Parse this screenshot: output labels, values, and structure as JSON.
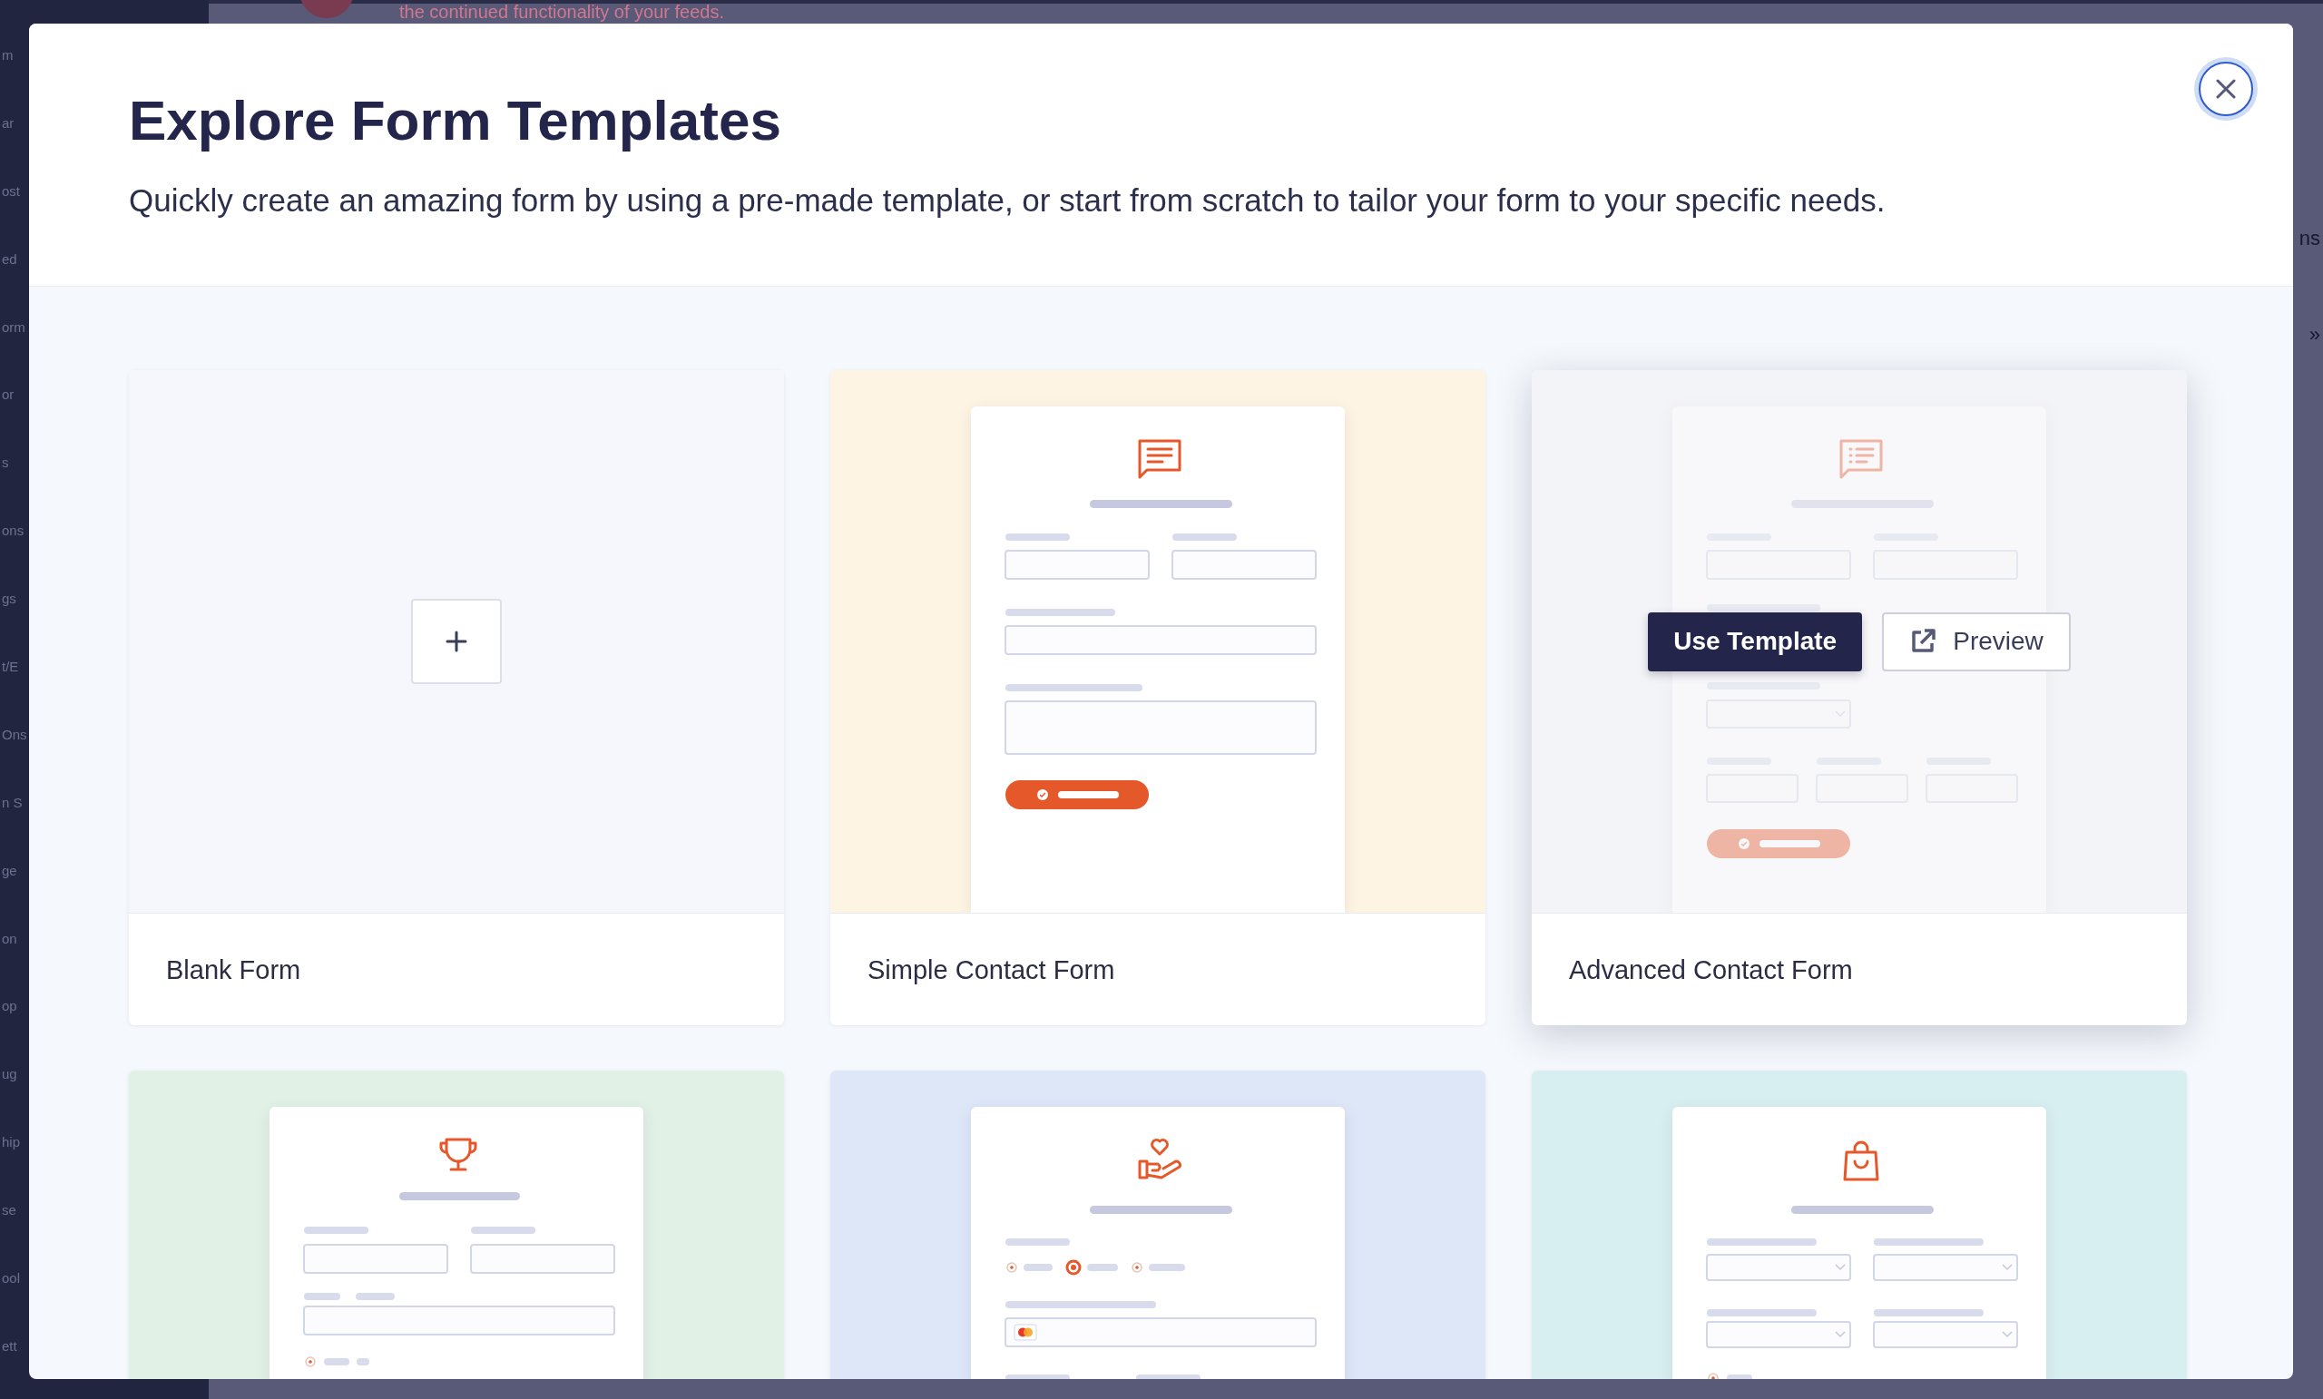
{
  "backdrop": {
    "notice": "the continued functionality of your feeds.",
    "sidebar_fragments": [
      "m",
      "ar",
      "ost",
      "ed",
      "orm",
      "or",
      "s",
      "ons",
      "gs",
      "t/E",
      "Ons",
      "n S",
      "ge",
      "on",
      "op",
      "ug",
      "hip",
      "se",
      "ool",
      "ett"
    ],
    "right_fragments": [
      "ns",
      "»"
    ]
  },
  "modal": {
    "title": "Explore Form Templates",
    "subtitle": "Quickly create an amazing form by using a pre-made template, or start from scratch to tailor your form to your specific needs.",
    "templates": [
      {
        "kind": "blank",
        "name": "Blank Form",
        "color": "#f5f7fc",
        "hovered": false
      },
      {
        "kind": "template",
        "name": "Simple Contact Form",
        "color": "#fdf4e3",
        "hovered": false
      },
      {
        "kind": "template",
        "name": "Advanced Contact Form",
        "color": "#f3f4f7",
        "hovered": true,
        "actions": [
          {
            "kind": "primary",
            "label": "Use Template"
          },
          {
            "kind": "secondary",
            "label": "Preview"
          }
        ]
      },
      {
        "kind": "template",
        "color": "#e2f1e6",
        "hovered": false
      },
      {
        "kind": "template",
        "color": "#dde7f8",
        "hovered": false
      },
      {
        "kind": "template",
        "color": "#d8eff1",
        "hovered": false
      }
    ]
  }
}
